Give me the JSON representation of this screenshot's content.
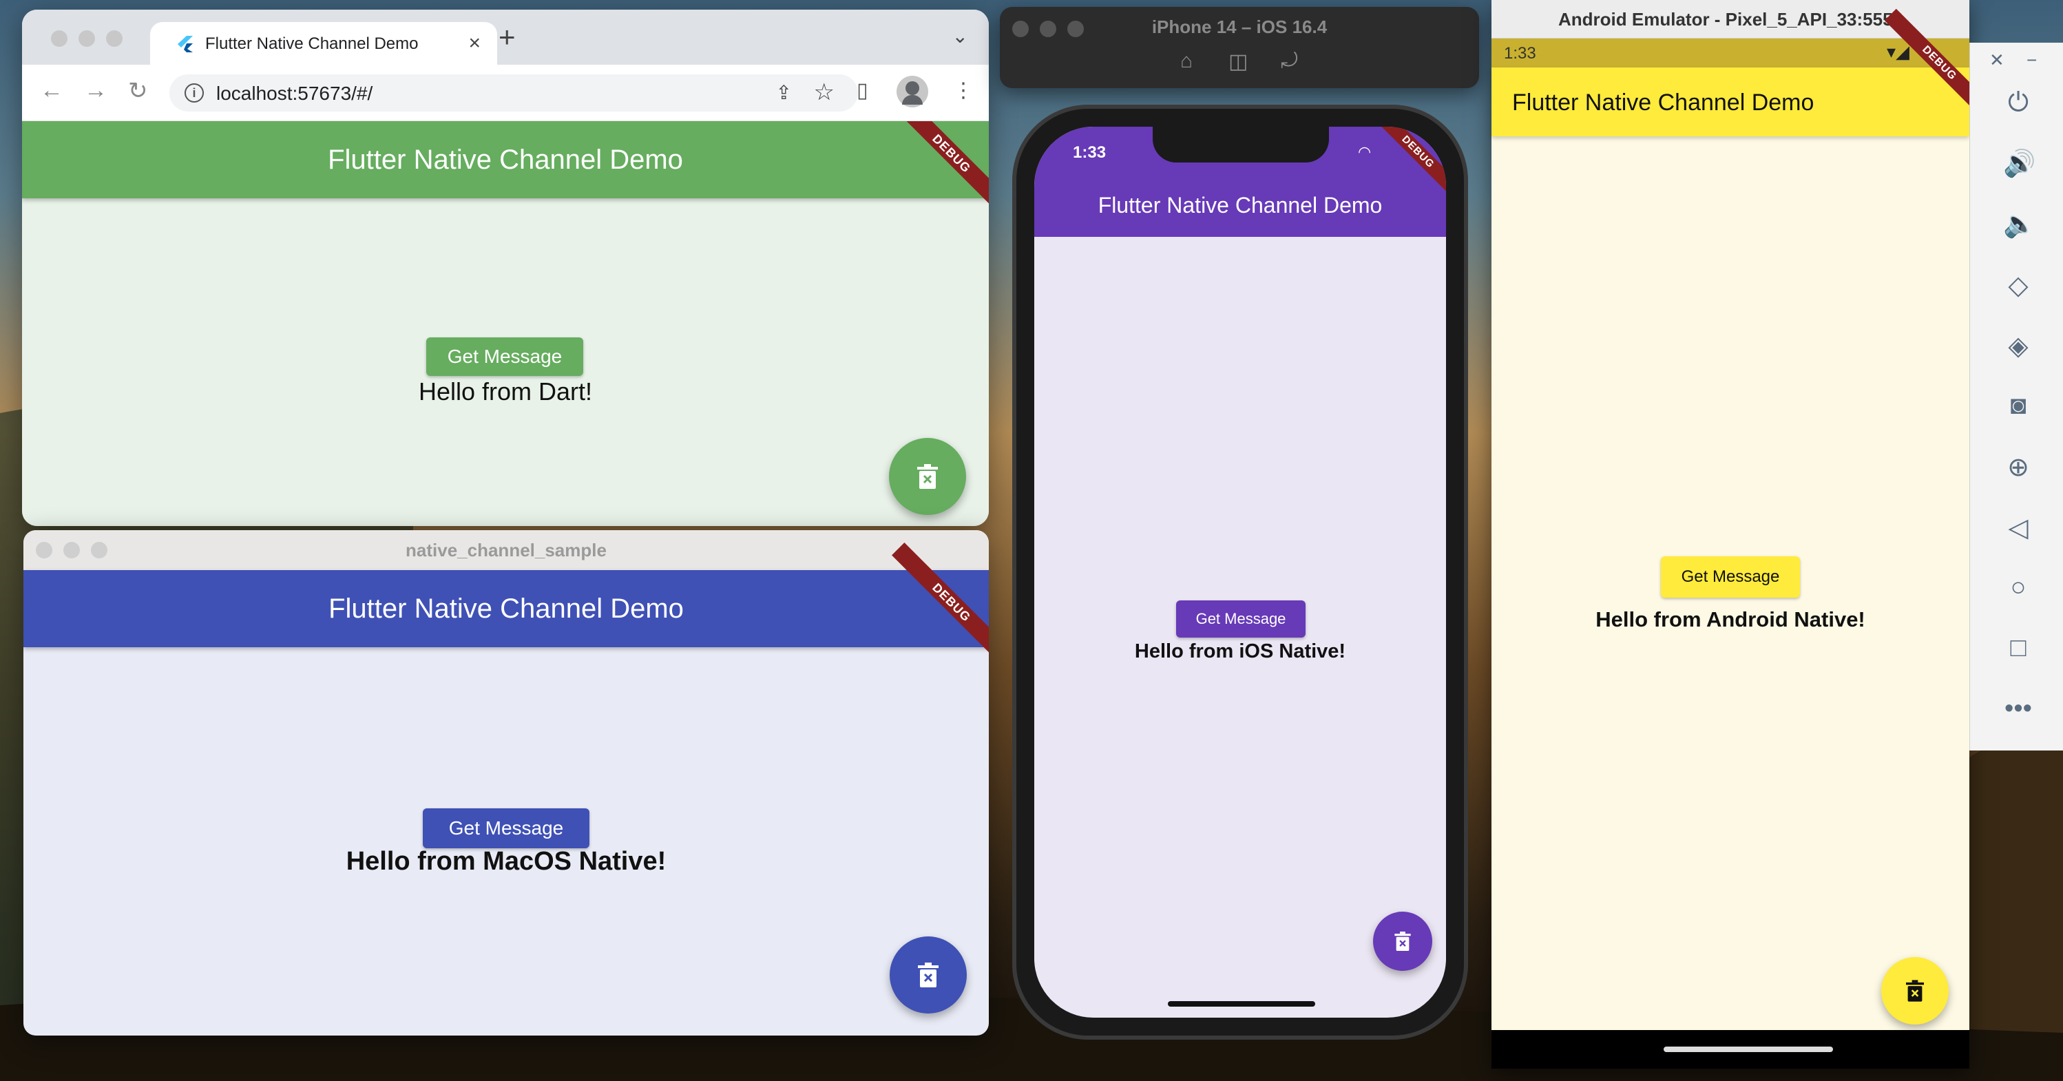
{
  "chrome": {
    "tab_title": "Flutter Native Channel Demo",
    "new_tab": "+",
    "close_tab": "×",
    "url": "localhost:57673/#/",
    "app": {
      "title": "Flutter Native Channel Demo",
      "debug": "DEBUG",
      "button": "Get Message",
      "message": "Hello from Dart!",
      "color": "#66ad5f"
    }
  },
  "macos": {
    "window_title": "native_channel_sample",
    "app": {
      "title": "Flutter Native Channel Demo",
      "debug": "DEBUG",
      "button": "Get Message",
      "message": "Hello from MacOS Native!",
      "color": "#3f51b5"
    }
  },
  "ios": {
    "simulator_title": "iPhone 14 – iOS 16.4",
    "time": "1:33",
    "app": {
      "title": "Flutter Native Channel Demo",
      "debug": "DEBUG",
      "button": "Get Message",
      "message": "Hello from iOS Native!",
      "color": "#673ab7"
    }
  },
  "android": {
    "window_title": "Android Emulator - Pixel_5_API_33:5554",
    "time": "1:33",
    "app": {
      "title": "Flutter Native Channel Demo",
      "debug": "DEBUG",
      "button": "Get Message",
      "message": "Hello from Android Native!",
      "color": "#ffeb3b"
    }
  },
  "emulator_toolbar": {
    "icons": [
      "power-icon",
      "volume-up-icon",
      "volume-down-icon",
      "rotate-left-icon",
      "rotate-right-icon",
      "camera-icon",
      "zoom-icon",
      "back-icon",
      "home-icon",
      "overview-icon",
      "more-icon"
    ]
  }
}
